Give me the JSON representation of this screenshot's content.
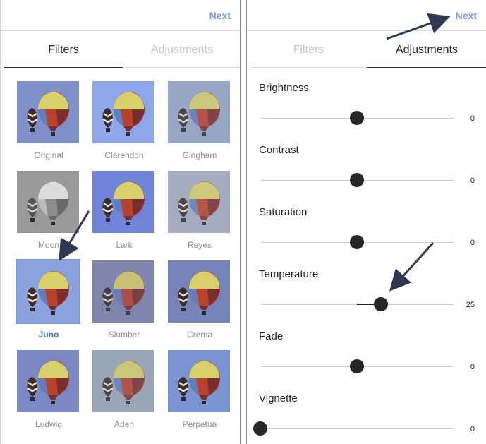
{
  "left_panel": {
    "next_label": "Next",
    "tabs": [
      {
        "label": "Filters",
        "active": true
      },
      {
        "label": "Adjustments",
        "active": false
      }
    ],
    "selected_filter": "Juno",
    "filters": [
      {
        "label": "Original",
        "bg": "#7e8fca",
        "tint": "none"
      },
      {
        "label": "Clarendon",
        "bg": "#8ea6ea",
        "tint": "none"
      },
      {
        "label": "Gingham",
        "bg": "#97a6c4",
        "tint": "soft"
      },
      {
        "label": "Moon",
        "bg": "#9a9a9a",
        "tint": "gray"
      },
      {
        "label": "Lark",
        "bg": "#6f84d8",
        "tint": "none"
      },
      {
        "label": "Reyes",
        "bg": "#a4adc0",
        "tint": "soft"
      },
      {
        "label": "Juno",
        "bg": "#8aa2dd",
        "tint": "none"
      },
      {
        "label": "Slumber",
        "bg": "#7f86ad",
        "tint": "soft"
      },
      {
        "label": "Crema",
        "bg": "#7682b8",
        "tint": "none"
      },
      {
        "label": "Ludwig",
        "bg": "#7c88c4",
        "tint": "none"
      },
      {
        "label": "Aden",
        "bg": "#98a6b8",
        "tint": "soft"
      },
      {
        "label": "Perpetua",
        "bg": "#7a93d2",
        "tint": "none"
      }
    ]
  },
  "right_panel": {
    "next_label": "Next",
    "tabs": [
      {
        "label": "Filters",
        "active": false
      },
      {
        "label": "Adjustments",
        "active": true
      }
    ],
    "adjustments": [
      {
        "label": "Brightness",
        "value": "0",
        "min": -100,
        "max": 100,
        "num": 0
      },
      {
        "label": "Contrast",
        "value": "0",
        "min": -100,
        "max": 100,
        "num": 0
      },
      {
        "label": "Saturation",
        "value": "0",
        "min": -100,
        "max": 100,
        "num": 0
      },
      {
        "label": "Temperature",
        "value": "25",
        "min": -100,
        "max": 100,
        "num": 25
      },
      {
        "label": "Fade",
        "value": "0",
        "min": -100,
        "max": 100,
        "num": 0
      },
      {
        "label": "Vignette",
        "value": "0",
        "min": 0,
        "max": 100,
        "num": 0
      }
    ]
  },
  "colors": {
    "accent": "#7f95d6",
    "selected_label": "#3f73c8",
    "arrow": "#2f3850"
  }
}
